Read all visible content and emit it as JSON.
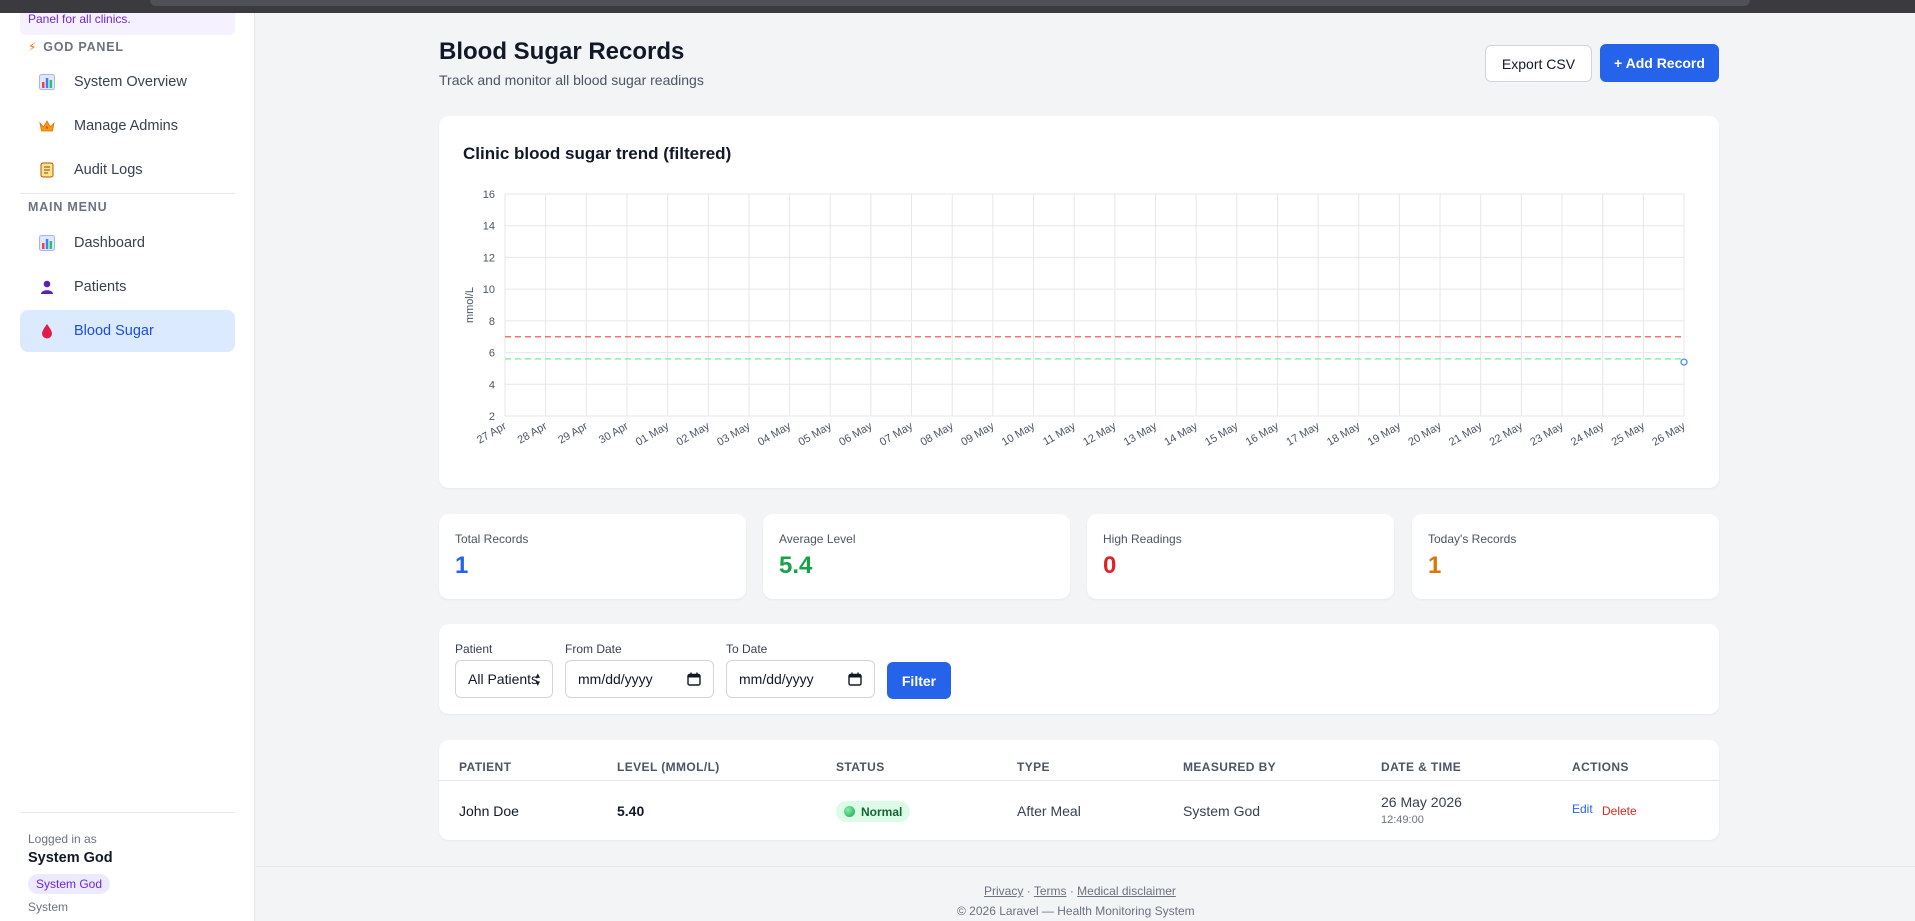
{
  "sidebar": {
    "note": "Panel for all clinics.",
    "god_section": "GOD PANEL",
    "god_items": [
      {
        "label": "System Overview"
      },
      {
        "label": "Manage Admins"
      },
      {
        "label": "Audit Logs"
      }
    ],
    "main_section": "MAIN MENU",
    "main_items": [
      {
        "label": "Dashboard"
      },
      {
        "label": "Patients"
      },
      {
        "label": "Blood Sugar",
        "active": true
      }
    ],
    "logged_in_label": "Logged in as",
    "user_name": "System God",
    "user_badge": "System God",
    "user_role": "System"
  },
  "header": {
    "title": "Blood Sugar Records",
    "subtitle": "Track and monitor all blood sugar readings",
    "export_label": "Export CSV",
    "add_label": "+ Add Record"
  },
  "chart_data": {
    "type": "line",
    "title": "Clinic blood sugar trend (filtered)",
    "ylabel": "mmol/L",
    "xlabel": "",
    "ylim": [
      2,
      16
    ],
    "yticks": [
      2,
      4,
      6,
      8,
      10,
      12,
      14,
      16
    ],
    "categories": [
      "27 Apr",
      "28 Apr",
      "29 Apr",
      "30 Apr",
      "01 May",
      "02 May",
      "03 May",
      "04 May",
      "05 May",
      "06 May",
      "07 May",
      "08 May",
      "09 May",
      "10 May",
      "11 May",
      "12 May",
      "13 May",
      "14 May",
      "15 May",
      "16 May",
      "17 May",
      "18 May",
      "19 May",
      "20 May",
      "21 May",
      "22 May",
      "23 May",
      "24 May",
      "25 May",
      "26 May"
    ],
    "series": [
      {
        "values": [
          null,
          null,
          null,
          null,
          null,
          null,
          null,
          null,
          null,
          null,
          null,
          null,
          null,
          null,
          null,
          null,
          null,
          null,
          null,
          null,
          null,
          null,
          null,
          null,
          null,
          null,
          null,
          null,
          null,
          5.4
        ],
        "color": "#3b82f6"
      }
    ],
    "reference_lines": [
      {
        "value": 7.0,
        "color": "#f87171"
      },
      {
        "value": 5.6,
        "color": "#86efac"
      }
    ],
    "grid": true
  },
  "stats": [
    {
      "label": "Total Records",
      "value": "1",
      "color": "#2563eb"
    },
    {
      "label": "Average Level",
      "value": "5.4",
      "color": "#16a34a"
    },
    {
      "label": "High Readings",
      "value": "0",
      "color": "#dc2626"
    },
    {
      "label": "Today's Records",
      "value": "1",
      "color": "#d97706"
    }
  ],
  "filters": {
    "patient_label": "Patient",
    "patient_value": "All Patients",
    "from_label": "From Date",
    "from_placeholder": "mm/dd/yyyy",
    "to_label": "To Date",
    "to_placeholder": "mm/dd/yyyy",
    "filter_button": "Filter"
  },
  "table": {
    "headers": [
      "PATIENT",
      "LEVEL (MMOL/L)",
      "STATUS",
      "TYPE",
      "MEASURED BY",
      "DATE & TIME",
      "ACTIONS"
    ],
    "rows": [
      {
        "patient": "John Doe",
        "level": "5.40",
        "status": "Normal",
        "type": "After Meal",
        "measured_by": "System God",
        "date": "26 May 2026",
        "time": "12:49:00",
        "edit": "Edit",
        "delete": "Delete"
      }
    ]
  },
  "footer": {
    "privacy": "Privacy",
    "sep": "·",
    "terms": "Terms",
    "disclaimer": "Medical disclaimer",
    "copyright": "© 2026 Laravel — Health Monitoring System"
  }
}
